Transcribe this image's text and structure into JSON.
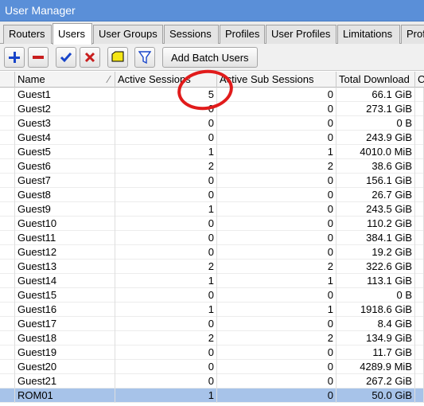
{
  "window": {
    "title": "User Manager"
  },
  "tabs": [
    "Routers",
    "Users",
    "User Groups",
    "Sessions",
    "Profiles",
    "User Profiles",
    "Limitations",
    "Profi"
  ],
  "active_tab": "Users",
  "toolbar": {
    "add_batch_label": "Add Batch Users"
  },
  "table": {
    "columns": [
      "Name",
      "Active Sessions",
      "Active Sub Sessions",
      "Total Download",
      "C"
    ],
    "rows": [
      {
        "name": "Guest1",
        "active": "5",
        "sub": "0",
        "download": "66.1 GiB"
      },
      {
        "name": "Guest2",
        "active": "0",
        "sub": "0",
        "download": "273.1 GiB"
      },
      {
        "name": "Guest3",
        "active": "0",
        "sub": "0",
        "download": "0 B"
      },
      {
        "name": "Guest4",
        "active": "0",
        "sub": "0",
        "download": "243.9 GiB"
      },
      {
        "name": "Guest5",
        "active": "1",
        "sub": "1",
        "download": "4010.0 MiB"
      },
      {
        "name": "Guest6",
        "active": "2",
        "sub": "2",
        "download": "38.6 GiB"
      },
      {
        "name": "Guest7",
        "active": "0",
        "sub": "0",
        "download": "156.1 GiB"
      },
      {
        "name": "Guest8",
        "active": "0",
        "sub": "0",
        "download": "26.7 GiB"
      },
      {
        "name": "Guest9",
        "active": "1",
        "sub": "0",
        "download": "243.5 GiB"
      },
      {
        "name": "Guest10",
        "active": "0",
        "sub": "0",
        "download": "110.2 GiB"
      },
      {
        "name": "Guest11",
        "active": "0",
        "sub": "0",
        "download": "384.1 GiB"
      },
      {
        "name": "Guest12",
        "active": "0",
        "sub": "0",
        "download": "19.2 GiB"
      },
      {
        "name": "Guest13",
        "active": "2",
        "sub": "2",
        "download": "322.6 GiB"
      },
      {
        "name": "Guest14",
        "active": "1",
        "sub": "1",
        "download": "113.1 GiB"
      },
      {
        "name": "Guest15",
        "active": "0",
        "sub": "0",
        "download": "0 B"
      },
      {
        "name": "Guest16",
        "active": "1",
        "sub": "1",
        "download": "1918.6 GiB"
      },
      {
        "name": "Guest17",
        "active": "0",
        "sub": "0",
        "download": "8.4 GiB"
      },
      {
        "name": "Guest18",
        "active": "2",
        "sub": "2",
        "download": "134.9 GiB"
      },
      {
        "name": "Guest19",
        "active": "0",
        "sub": "0",
        "download": "11.7 GiB"
      },
      {
        "name": "Guest20",
        "active": "0",
        "sub": "0",
        "download": "4289.9 MiB"
      },
      {
        "name": "Guest21",
        "active": "0",
        "sub": "0",
        "download": "267.2 GiB"
      },
      {
        "name": "ROM01",
        "active": "1",
        "sub": "0",
        "download": "50.0 GiB"
      }
    ],
    "selected_row": "ROM01"
  },
  "colors": {
    "titlebar": "#5a8fd8",
    "selection": "#a7c3e9",
    "add_icon": "#1744c9",
    "remove_icon": "#c81e1e",
    "annotation": "#e11b1b"
  },
  "icons": [
    "plus-icon",
    "minus-icon",
    "check-icon",
    "cross-icon",
    "comment-icon",
    "filter-icon",
    "sort-icon"
  ]
}
